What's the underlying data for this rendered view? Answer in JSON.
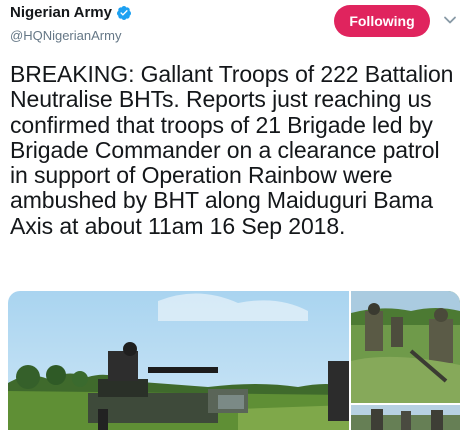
{
  "account": {
    "display_name": "Nigerian Army",
    "handle": "@HQNigerianArmy",
    "verified_icon": "verified-badge-icon"
  },
  "actions": {
    "follow_label": "Following",
    "more_icon": "chevron-down-icon"
  },
  "tweet": {
    "text": "BREAKING: Gallant Troops of 222 Battalion Neutralise BHTs. Reports just reaching us confirmed that troops of 21 Brigade led by Brigade Commander on a clearance patrol in support of Operation Rainbow were ambushed by BHT along Maiduguri Bama Axis at about 11am 16 Sep 2018."
  },
  "colors": {
    "follow_button": "#e0245e",
    "verified": "#1da1f2",
    "handle": "#657786",
    "text": "#14171a"
  }
}
